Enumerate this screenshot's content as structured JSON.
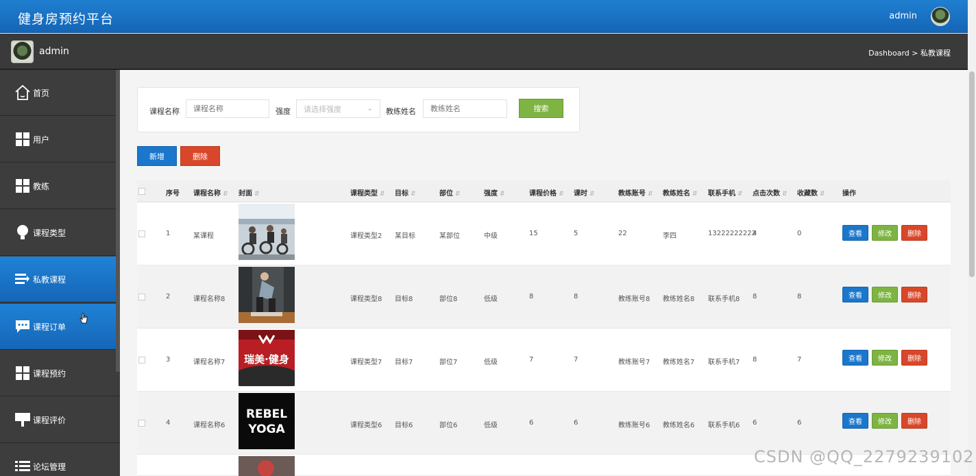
{
  "header": {
    "title": "健身房预约平台",
    "user": "admin"
  },
  "subheader": {
    "username": "admin",
    "breadcrumb": "Dashboard > 私教课程"
  },
  "sidebar": {
    "items": [
      {
        "label": "首页",
        "icon": "home-icon"
      },
      {
        "label": "用户",
        "icon": "grid-icon"
      },
      {
        "label": "教练",
        "icon": "grid-icon"
      },
      {
        "label": "课程类型",
        "icon": "bulb-icon"
      },
      {
        "label": "私教课程",
        "icon": "list-icon",
        "active": true
      },
      {
        "label": "课程订单",
        "icon": "chat-icon",
        "active": true
      },
      {
        "label": "课程预约",
        "icon": "grid-icon"
      },
      {
        "label": "课程评价",
        "icon": "board-icon"
      },
      {
        "label": "论坛管理",
        "icon": "list-icon"
      }
    ]
  },
  "search": {
    "course_name_label": "课程名称",
    "course_name_placeholder": "课程名称",
    "intensity_label": "强度",
    "intensity_placeholder": "请选择强度",
    "coach_name_label": "教练姓名",
    "coach_name_placeholder": "教练姓名",
    "search_button": "搜索"
  },
  "actions": {
    "add": "新增",
    "delete": "删除"
  },
  "table": {
    "headers": [
      "序号",
      "课程名称",
      "封面",
      "课程类型",
      "目标",
      "部位",
      "强度",
      "课程价格",
      "课时",
      "教练账号",
      "教练姓名",
      "联系手机",
      "点击次数",
      "收藏数",
      "操作"
    ],
    "row_buttons": {
      "view": "查看",
      "edit": "修改",
      "remove": "删除"
    },
    "rows": [
      {
        "no": "1",
        "name": "某课程",
        "type": "课程类型2",
        "goal": "某目标",
        "part": "某部位",
        "intensity": "中级",
        "price": "15",
        "hours": "5",
        "account": "22",
        "coach": "李四",
        "phone": "13222222222",
        "clicks": "4",
        "favs": "0",
        "cover": "spin-class"
      },
      {
        "no": "2",
        "name": "课程名称8",
        "type": "课程类型8",
        "goal": "目标8",
        "part": "部位8",
        "intensity": "低级",
        "price": "8",
        "hours": "8",
        "account": "教练账号8",
        "coach": "教练姓名8",
        "phone": "联系手机8",
        "clicks": "8",
        "favs": "8",
        "cover": "squat-training"
      },
      {
        "no": "3",
        "name": "课程名称7",
        "type": "课程类型7",
        "goal": "目标7",
        "part": "部位7",
        "intensity": "低级",
        "price": "7",
        "hours": "7",
        "account": "教练账号7",
        "coach": "教练姓名7",
        "phone": "联系手机7",
        "clicks": "8",
        "favs": "7",
        "cover": "gym-sign",
        "cover_text": "瑞美·健身"
      },
      {
        "no": "4",
        "name": "课程名称6",
        "type": "课程类型6",
        "goal": "目标6",
        "part": "部位6",
        "intensity": "低级",
        "price": "6",
        "hours": "6",
        "account": "教练账号6",
        "coach": "教练姓名6",
        "phone": "联系手机6",
        "clicks": "6",
        "favs": "6",
        "cover": "rebel-yoga",
        "cover_text_1": "REBEL",
        "cover_text_2": "YOGA"
      }
    ]
  },
  "watermark": "CSDN @QQ_2279239102",
  "colors": {
    "primary": "#1a77cc",
    "success": "#7eb442",
    "danger": "#d9472a",
    "sidebar": "#3d3d3d"
  }
}
